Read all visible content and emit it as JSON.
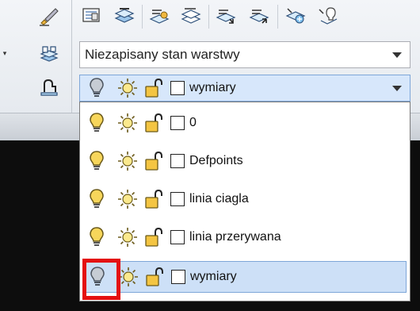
{
  "toolbar": {
    "left_tools": [
      {
        "icon": "brush-icon"
      },
      {
        "icon": "layer-stack-icon"
      },
      {
        "icon": "layer-walk-icon"
      }
    ],
    "top_buttons": [
      {
        "icon": "layer-properties-icon"
      },
      {
        "icon": "layer-states-icon"
      },
      {
        "icon": "layer-match-icon"
      },
      {
        "icon": "layer-previous-icon"
      },
      {
        "icon": "layer-isolate-icon"
      },
      {
        "icon": "layer-unisolate-icon"
      },
      {
        "icon": "layer-freeze-icon"
      },
      {
        "icon": "layer-off-icon"
      }
    ]
  },
  "layer_state_combo": {
    "value": "Niezapisany stan warstwy"
  },
  "layer_combo": {
    "current": "wymiary"
  },
  "layers": [
    {
      "name": "0"
    },
    {
      "name": "Defpoints"
    },
    {
      "name": "linia ciagla"
    },
    {
      "name": "linia przerywana"
    },
    {
      "name": "wymiary"
    }
  ],
  "colors": {
    "bulb_on": "#f7d65b",
    "bulb_off": "#c6ccd4",
    "highlight": "#e41010",
    "selected_row": "#cde0f7"
  }
}
